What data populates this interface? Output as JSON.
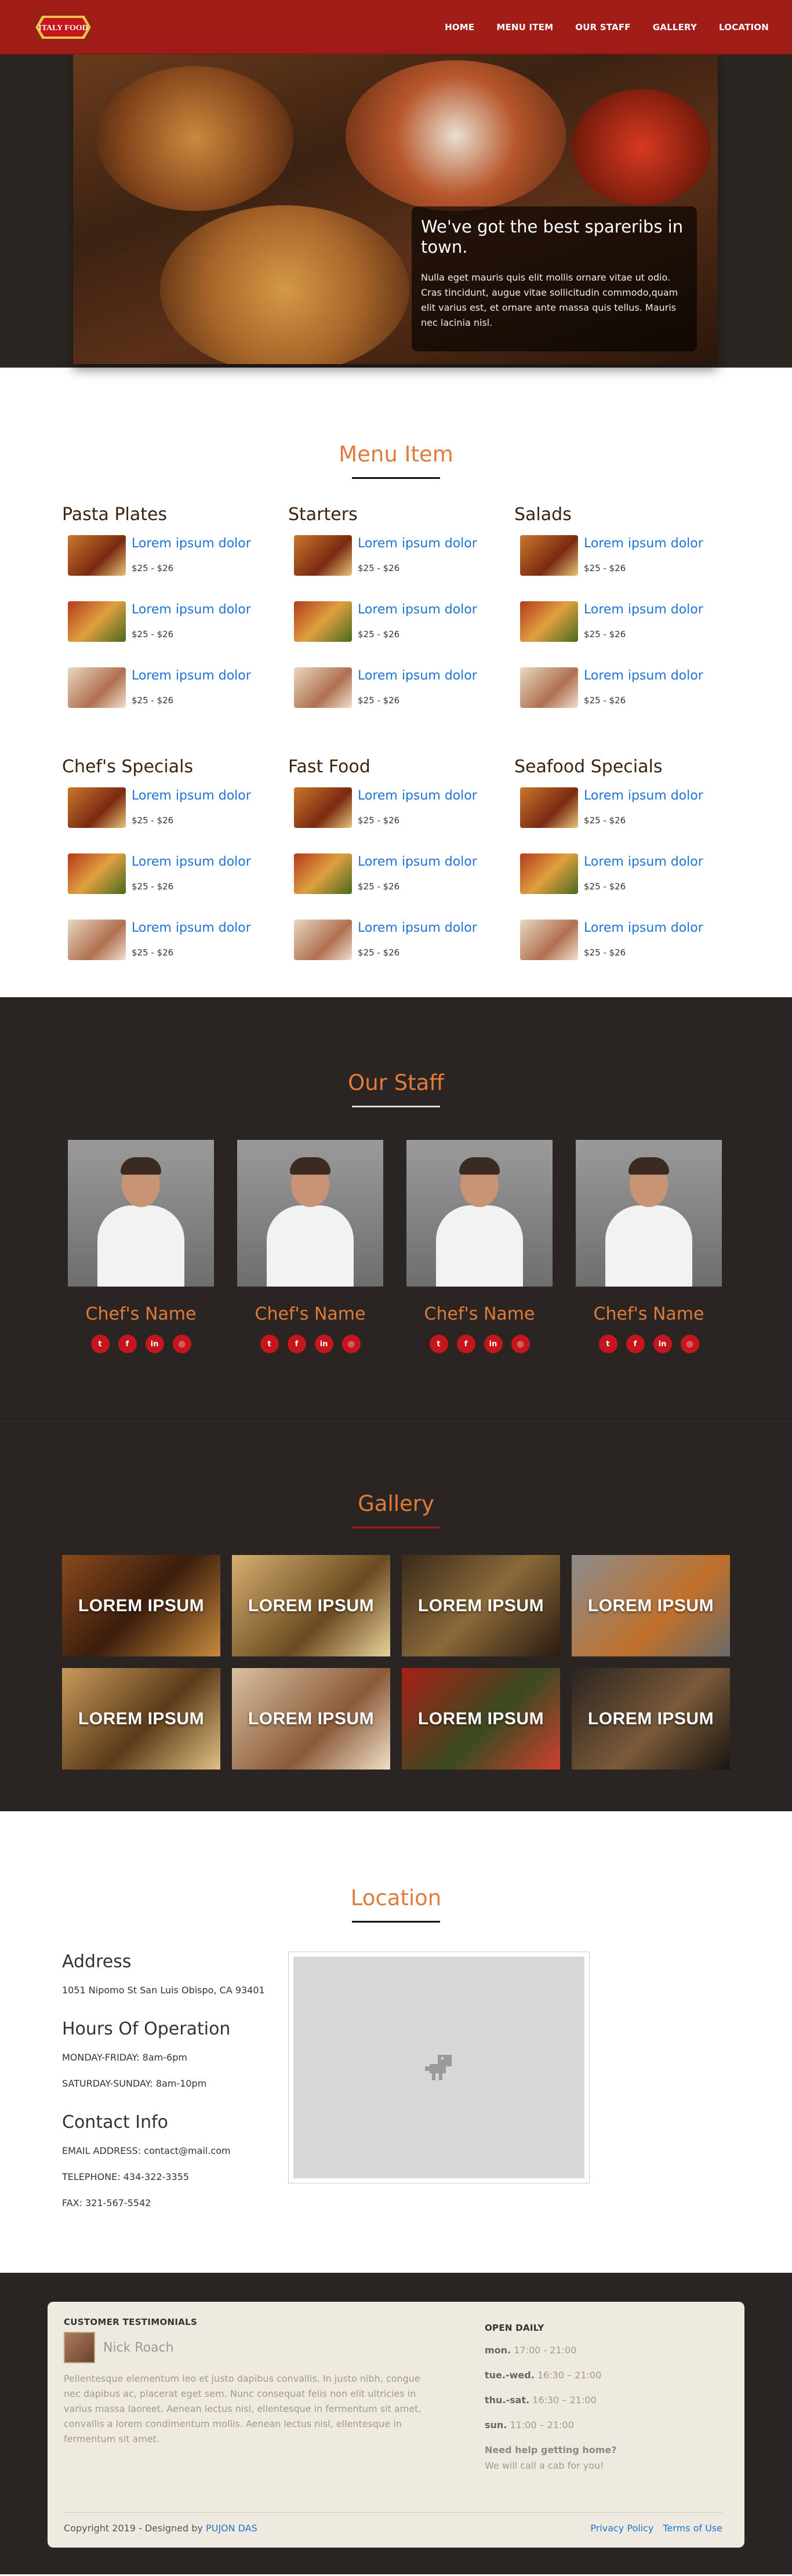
{
  "brand": {
    "logo_text": "ITALY FOOD"
  },
  "nav": {
    "items": [
      "HOME",
      "MENU ITEM",
      "OUR STAFF",
      "GALLERY",
      "LOCATION"
    ]
  },
  "hero": {
    "title": "We've got the best spareribs in town.",
    "text": "Nulla eget mauris quis elit mollis ornare vitae ut odio. Cras tincidunt, augue vitae sollicitudin commodo,quam elit varius est, et ornare ante massa quis tellus. Mauris nec lacinia nisl."
  },
  "menu": {
    "title": "Menu Item",
    "categories": [
      {
        "name": "Pasta Plates",
        "items": [
          {
            "name": "Lorem ipsum dolor",
            "price": "$25 - $26"
          },
          {
            "name": "Lorem ipsum dolor",
            "price": "$25 - $26"
          },
          {
            "name": "Lorem ipsum dolor",
            "price": "$25 - $26"
          }
        ]
      },
      {
        "name": "Starters",
        "items": [
          {
            "name": "Lorem ipsum dolor",
            "price": "$25 - $26"
          },
          {
            "name": "Lorem ipsum dolor",
            "price": "$25 - $26"
          },
          {
            "name": "Lorem ipsum dolor",
            "price": "$25 - $26"
          }
        ]
      },
      {
        "name": "Salads",
        "items": [
          {
            "name": "Lorem ipsum dolor",
            "price": "$25 - $26"
          },
          {
            "name": "Lorem ipsum dolor",
            "price": "$25 - $26"
          },
          {
            "name": "Lorem ipsum dolor",
            "price": "$25 - $26"
          }
        ]
      },
      {
        "name": "Chef's Specials",
        "items": [
          {
            "name": "Lorem ipsum dolor",
            "price": "$25 - $26"
          },
          {
            "name": "Lorem ipsum dolor",
            "price": "$25 - $26"
          },
          {
            "name": "Lorem ipsum dolor",
            "price": "$25 - $26"
          }
        ]
      },
      {
        "name": "Fast Food",
        "items": [
          {
            "name": "Lorem ipsum dolor",
            "price": "$25 - $26"
          },
          {
            "name": "Lorem ipsum dolor",
            "price": "$25 - $26"
          },
          {
            "name": "Lorem ipsum dolor",
            "price": "$25 - $26"
          }
        ]
      },
      {
        "name": "Seafood Specials",
        "items": [
          {
            "name": "Lorem ipsum dolor",
            "price": "$25 - $26"
          },
          {
            "name": "Lorem ipsum dolor",
            "price": "$25 - $26"
          },
          {
            "name": "Lorem ipsum dolor",
            "price": "$25 - $26"
          }
        ]
      }
    ]
  },
  "staff": {
    "title": "Our Staff",
    "chefs": [
      {
        "name": "Chef's Name"
      },
      {
        "name": "Chef's Name"
      },
      {
        "name": "Chef's Name"
      },
      {
        "name": "Chef's Name"
      }
    ],
    "social_icons": [
      "twitter-icon",
      "facebook-icon",
      "linkedin-icon",
      "instagram-icon"
    ]
  },
  "gallery": {
    "title": "Gallery",
    "tiles": [
      "LOREM IPSUM",
      "LOREM IPSUM",
      "LOREM IPSUM",
      "LOREM IPSUM",
      "LOREM IPSUM",
      "LOREM IPSUM",
      "LOREM IPSUM",
      "LOREM IPSUM"
    ]
  },
  "location": {
    "title": "Location",
    "address_title": "Address",
    "address": "1051 Nipomo St San Luis Obispo, CA 93401",
    "hours_title": "Hours Of Operation",
    "hours_weekday": "MONDAY-FRIDAY: 8am-6pm",
    "hours_weekend": "SATURDAY-SUNDAY: 8am-10pm",
    "contact_title": "Contact Info",
    "email": "EMAIL ADDRESS: contact@mail.com",
    "telephone": "TELEPHONE: 434-322-3355",
    "fax": "FAX: 321-567-5542"
  },
  "footer": {
    "testimonials_title": "CUSTOMER TESTIMONIALS",
    "person_name": "Nick Roach",
    "testimonial": "Pellentesque elementum leo et justo dapibus convallis. In justo nibh, congue nec dapibus ac, placerat eget sem. Nunc consequat felis non elit ultricies in varius massa laoreet. Aenean lectus nisl, ellentesque in fermentum sit amet, convallis a lorem condimentum mollis. Aenean lectus nisl, ellentesque in fermentum sit amet.",
    "open_title": "OPEN DAILY",
    "open_hours": [
      {
        "day": "mon.",
        "time": "17:00 - 21:00"
      },
      {
        "day": "tue.-wed.",
        "time": "16:30 – 21:00"
      },
      {
        "day": "thu.-sat.",
        "time": "16:30 – 21:00"
      },
      {
        "day": "sun.",
        "time": "11:00 – 21:00"
      }
    ],
    "help_title": "Need help getting home?",
    "help_text": "We will call a cab for you!",
    "copyright": "Copyright 2019 - Designed by ",
    "designer": "PUJON DAS",
    "privacy": "Privacy Policy",
    "terms": "Terms of Use"
  },
  "colors": {
    "brand_red": "#a11d18",
    "accent_orange": "#e07b39",
    "link_blue": "#1e73d8",
    "dark_bg": "#2a2522"
  }
}
